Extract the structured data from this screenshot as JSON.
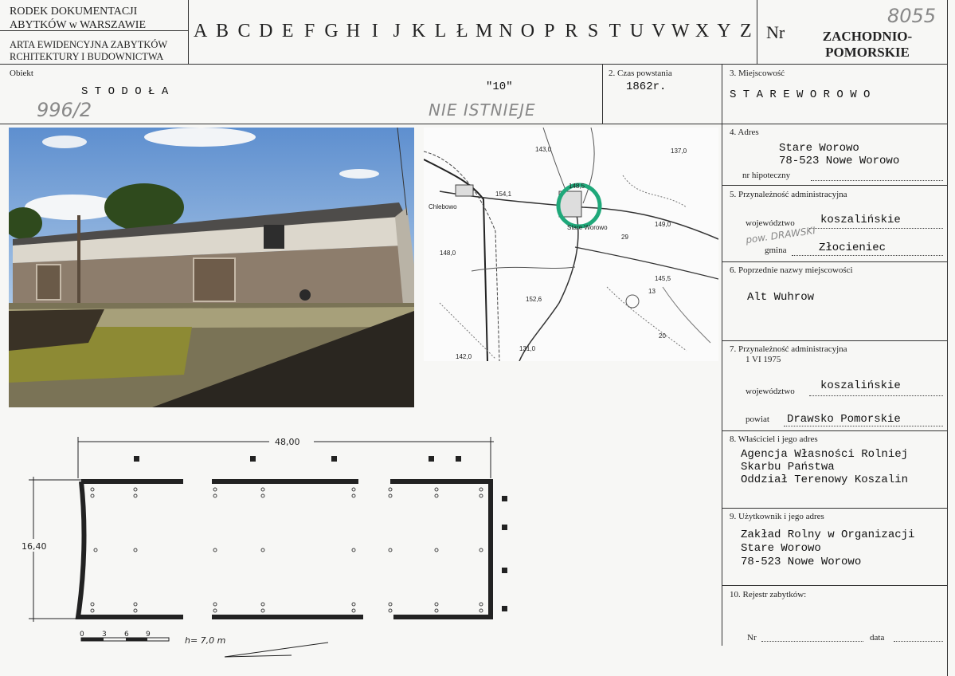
{
  "header": {
    "institution_line1": "RODEK DOKUMENTACJI",
    "institution_line2": "ABYTKÓW w WARSZAWIE",
    "card_line1": "ARTA EWIDENCYJNA ZABYTKÓW",
    "card_line2": "RCHITEKTURY I BUDOWNICTWA",
    "alphabet": [
      "A",
      "B",
      "C",
      "D",
      "E",
      "F",
      "G",
      "H",
      "I",
      "J",
      "K",
      "L",
      "Ł",
      "M",
      "N",
      "O",
      "P",
      "R",
      "S",
      "T",
      "U",
      "V",
      "W",
      "X",
      "Y",
      "Z"
    ],
    "nr_label": "Nr",
    "region": [
      "ZACHODNIO-",
      "POMORSKIE"
    ],
    "handwritten_number": "8055"
  },
  "object": {
    "label": "Obiekt",
    "name": "S T O D O Ł A",
    "number": "\"10\"",
    "handwritten_ref": "996/2",
    "handwritten_note": "NIE ISTNIEJE"
  },
  "time": {
    "label": "2. Czas powstania",
    "value": "1862r."
  },
  "place": {
    "label": "3. Miejscowość",
    "value": "S T A R E    W O R O W O"
  },
  "address": {
    "label": "4. Adres",
    "line1": "Stare Worowo",
    "line2": "78-523 Nowe Worowo",
    "mortgage_label": "nr hipoteczny"
  },
  "admin": {
    "label": "5. Przynależność administracyjna",
    "voivodeship_label": "województwo",
    "voivodeship_value": "koszalińskie",
    "handwritten_powiat": "pow. DRAWSKI",
    "gmina_label": "gmina",
    "gmina_value": "Złocieniec"
  },
  "former_names": {
    "label": "6. Poprzednie nazwy miejscowości",
    "value": "Alt Wuhrow"
  },
  "admin1975": {
    "label": "7. Przynależność administracyjna",
    "date": "1 VI 1975",
    "voivodeship_label": "województwo",
    "voivodeship_value": "koszalińskie",
    "powiat_label": "powiat",
    "powiat_value": "Drawsko Pomorskie"
  },
  "owner": {
    "label": "8. Właściciel i jego adres",
    "lines": [
      "Agencja Własności Rolniej",
      "Skarbu Państwa",
      "Oddział Terenowy Koszalin"
    ]
  },
  "user": {
    "label": "9. Użytkownik i jego adres",
    "lines": [
      "Zakład Rolny w Organizacji",
      "Stare Worowo",
      "78-523 Nowe Worowo"
    ]
  },
  "register": {
    "label": "10. Rejestr zabytków:",
    "nr_label": "Nr",
    "date_label": "data"
  },
  "map": {
    "labels": [
      "143,0",
      "137,0",
      "154,1",
      "Chlebowo",
      "148,5",
      "Stare Worowo",
      "149,0",
      "148,0",
      "145,5",
      "152,6",
      "131,0",
      "142,0",
      "20",
      "29",
      "13"
    ],
    "marker_color": "#1fa87a"
  },
  "plan": {
    "width_dim": "48,00",
    "depth_dim": "16,40",
    "scale_ticks": [
      "0",
      "3",
      "6",
      "9"
    ],
    "height_note": "h= 7,0 m"
  },
  "colors": {
    "sky": "#6f9fd6",
    "stone": "#8a7c6c",
    "plaster": "#d9d4c8",
    "grass": "#8c8a3a"
  }
}
